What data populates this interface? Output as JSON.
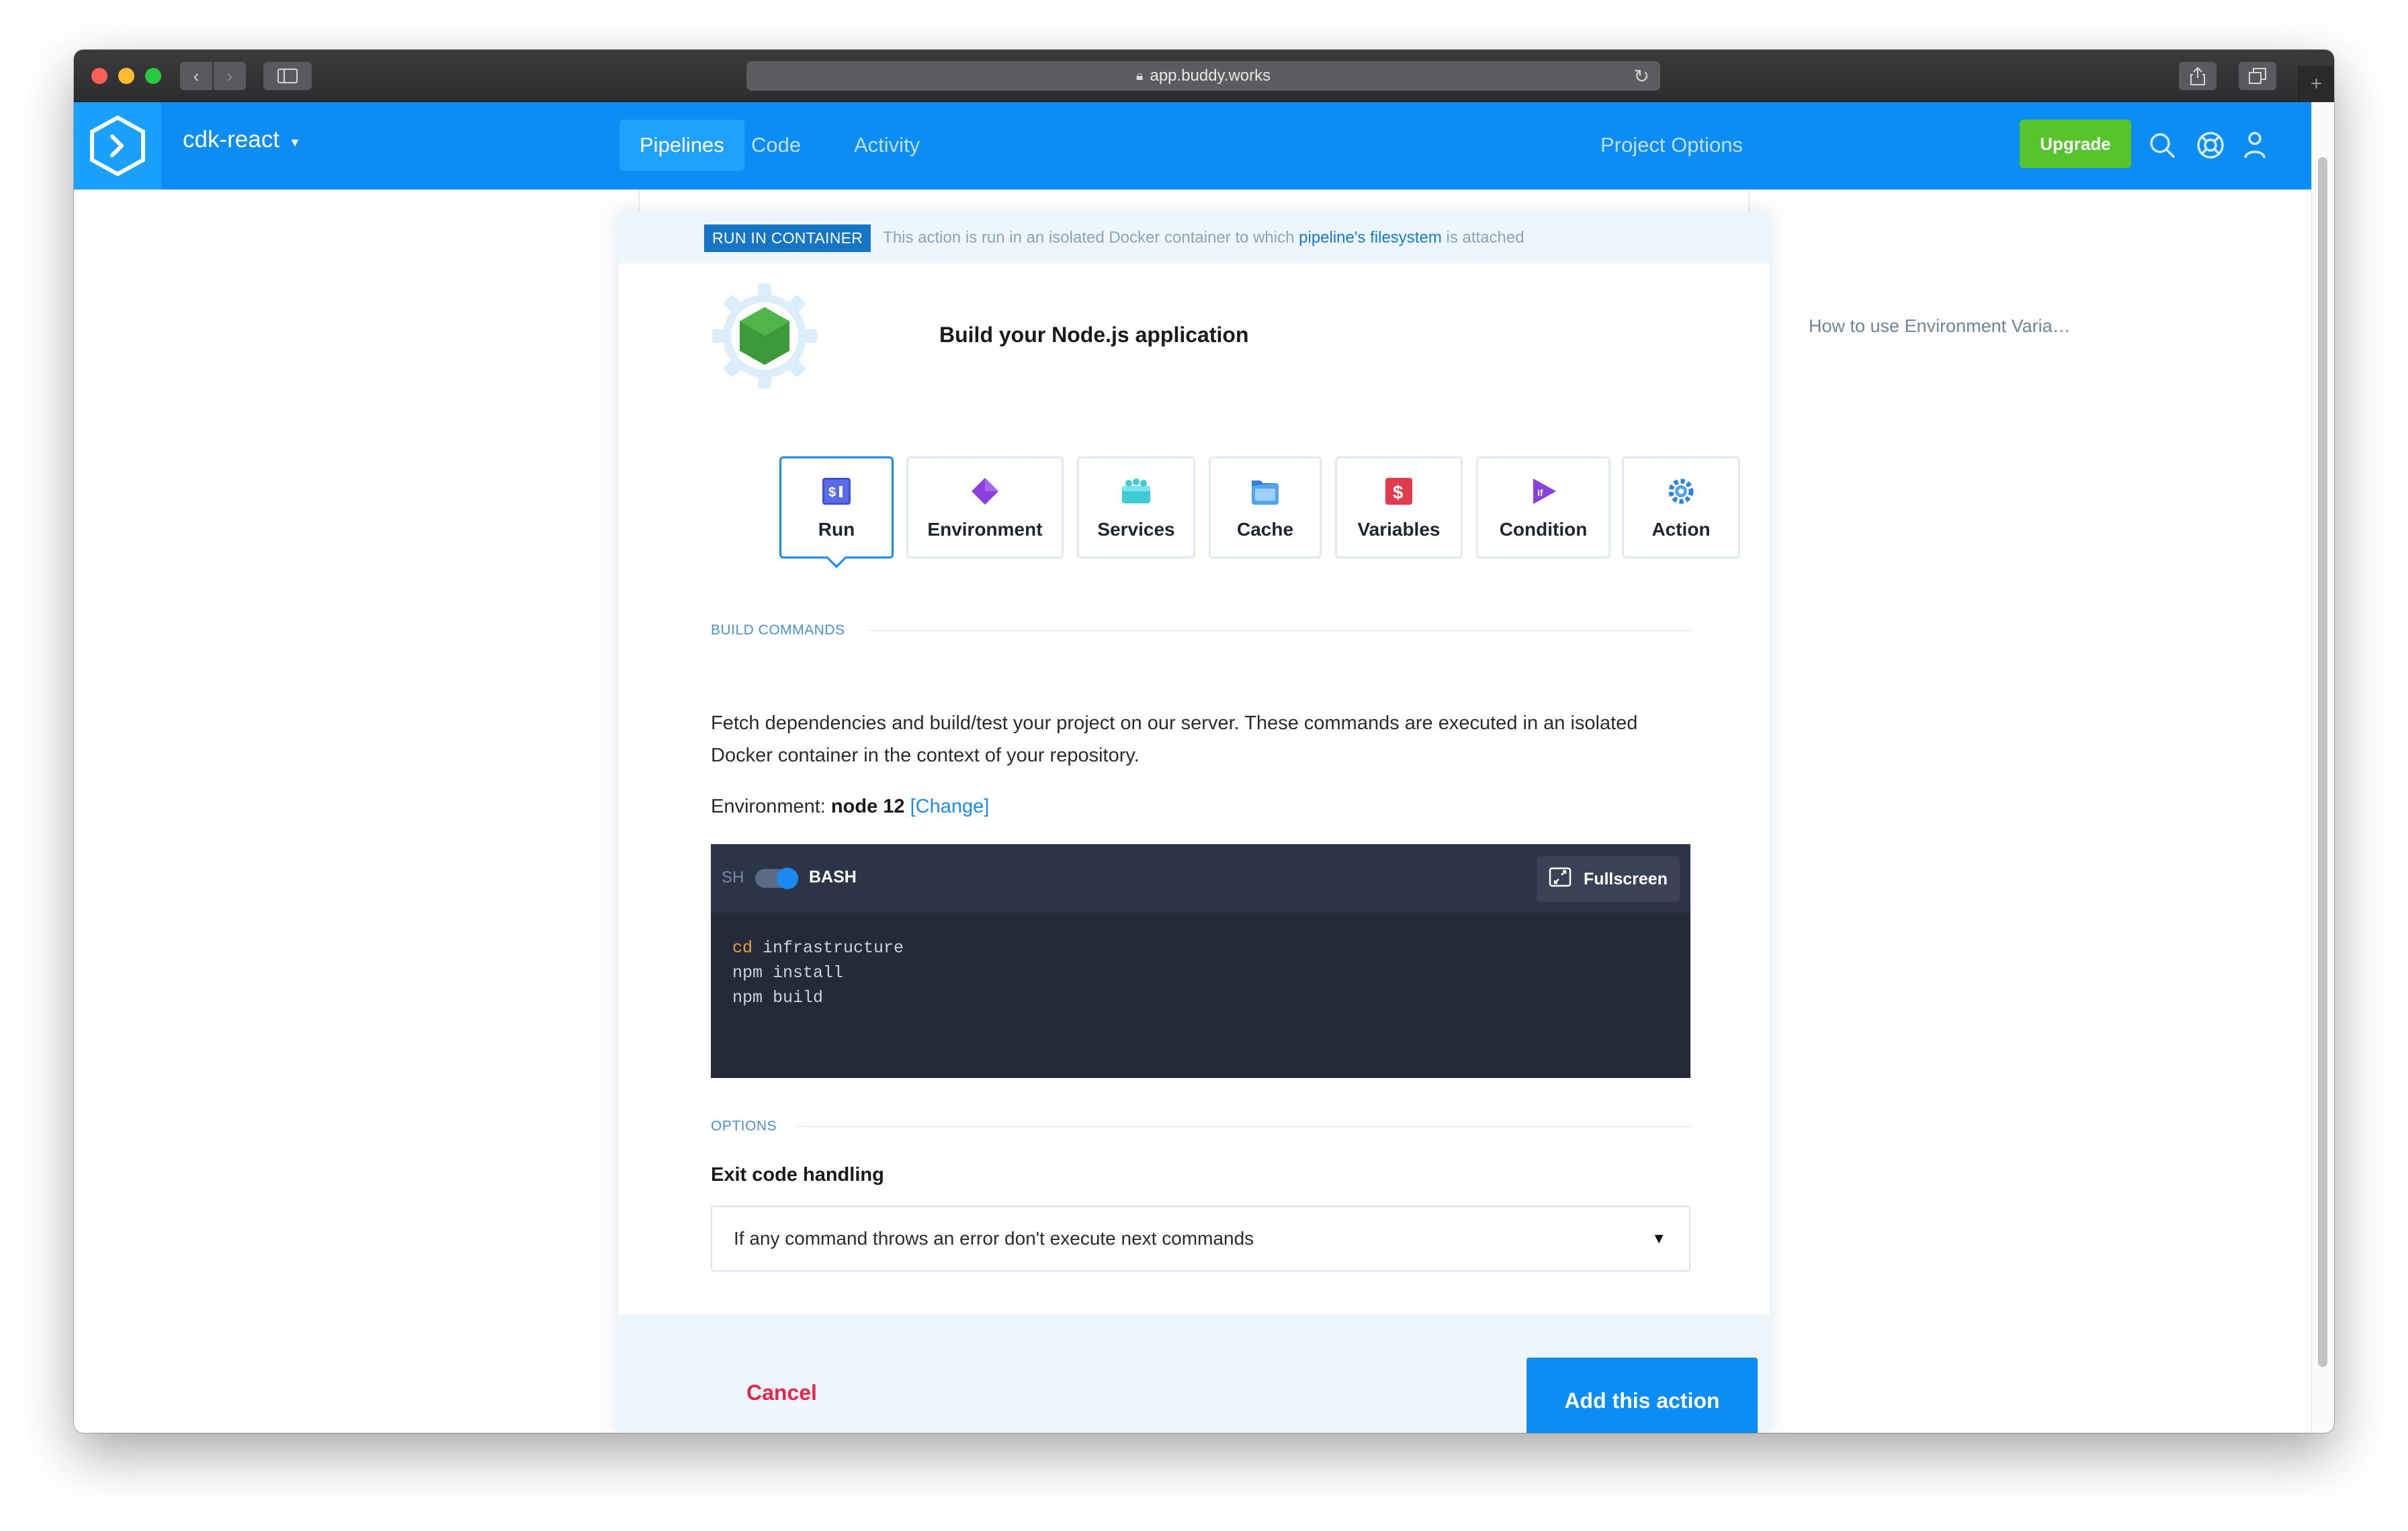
{
  "browser": {
    "url": "app.buddy.works"
  },
  "header": {
    "project_name": "cdk-react",
    "tabs": [
      {
        "label": "Pipelines",
        "active": true
      },
      {
        "label": "Code",
        "active": false
      },
      {
        "label": "Activity",
        "active": false
      }
    ],
    "project_options": "Project Options",
    "upgrade_label": "Upgrade"
  },
  "notice": {
    "badge": "RUN IN CONTAINER",
    "text_before": "This action is run in an isolated Docker container to which",
    "link": "pipeline's filesystem",
    "text_after": "is attached"
  },
  "action": {
    "title": "Build your Node.js application"
  },
  "action_tabs": [
    {
      "label": "Run",
      "icon": "run-icon",
      "active": true
    },
    {
      "label": "Environment",
      "icon": "environment-icon",
      "active": false
    },
    {
      "label": "Services",
      "icon": "services-icon",
      "active": false
    },
    {
      "label": "Cache",
      "icon": "cache-icon",
      "active": false
    },
    {
      "label": "Variables",
      "icon": "variables-icon",
      "active": false
    },
    {
      "label": "Condition",
      "icon": "condition-icon",
      "active": false
    },
    {
      "label": "Action",
      "icon": "action-icon",
      "active": false
    }
  ],
  "build": {
    "section_label": "BUILD COMMANDS",
    "description": "Fetch dependencies and build/test your project on our server. These commands are executed in an isolated Docker container in the context of your repository.",
    "env_prefix": "Environment:",
    "env_value": "node 12",
    "env_change": "[Change]"
  },
  "editor": {
    "sh_label": "SH",
    "bash_label": "BASH",
    "fullscreen_label": "Fullscreen",
    "lines": [
      {
        "kw": "cd",
        "rest": " infrastructure"
      },
      {
        "kw": "",
        "rest": "npm install"
      },
      {
        "kw": "",
        "rest": "npm build"
      }
    ]
  },
  "options": {
    "section_label": "OPTIONS",
    "exit_title": "Exit code handling",
    "exit_value": "If any command throws an error don't execute next commands"
  },
  "footer": {
    "cancel_label": "Cancel",
    "add_label": "Add this action"
  },
  "sidebar": {
    "help_link": "How to use Environment Varia…"
  },
  "colors": {
    "brand_blue": "#0c8cf5",
    "upgrade_green": "#56c52d",
    "cancel_red": "#e3264a",
    "chat_purple": "#6b21a8"
  }
}
